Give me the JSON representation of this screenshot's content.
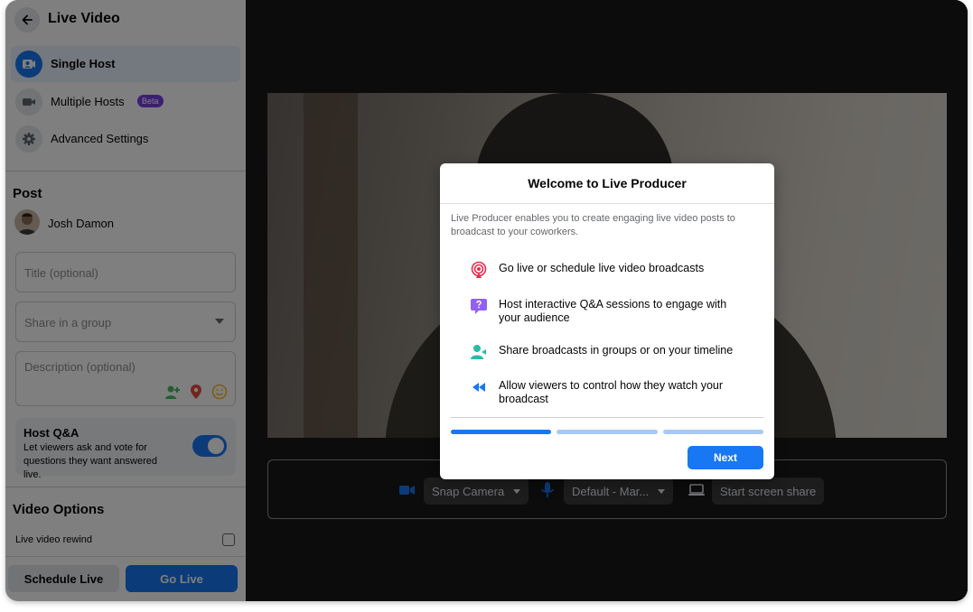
{
  "sidebar": {
    "title": "Live Video",
    "nav": [
      {
        "label": "Single Host",
        "icon": "user-video-icon",
        "active": true
      },
      {
        "label": "Multiple Hosts",
        "icon": "video-camera-icon",
        "badge": "Beta"
      },
      {
        "label": "Advanced Settings",
        "icon": "gear-icon"
      }
    ],
    "post": {
      "title": "Post",
      "user_name": "Josh Damon",
      "title_placeholder": "Title (optional)",
      "group_placeholder": "Share in a group",
      "description_placeholder": "Description (optional)"
    },
    "qa": {
      "title": "Host Q&A",
      "description": "Let viewers ask and vote for questions they want answered live.",
      "enabled": true
    },
    "video_options": {
      "title": "Video Options",
      "rewind_label": "Live video rewind",
      "rewind_checked": false
    },
    "footer": {
      "schedule_label": "Schedule Live",
      "golive_label": "Go Live"
    }
  },
  "controls": {
    "camera_label": "Snap Camera",
    "mic_label": "Default - Mar...",
    "screen_share_label": "Start screen share"
  },
  "modal": {
    "title": "Welcome to Live Producer",
    "intro": "Live Producer enables you to create engaging live video posts to broadcast to your coworkers.",
    "features": [
      {
        "text": "Go live or schedule live video broadcasts",
        "icon": "broadcast-icon"
      },
      {
        "text": "Host interactive Q&A sessions to engage with your audience",
        "icon": "question-bubble-icon"
      },
      {
        "text": "Share broadcasts in groups or on your timeline",
        "icon": "share-group-icon"
      },
      {
        "text": "Allow viewers to control how they watch your broadcast",
        "icon": "rewind-icon"
      }
    ],
    "progress_steps": 3,
    "current_step": 1,
    "next_label": "Next"
  },
  "colors": {
    "accent": "#1877f2",
    "beta": "#7a3fe4",
    "progress_inactive": "#a8c9f5"
  }
}
